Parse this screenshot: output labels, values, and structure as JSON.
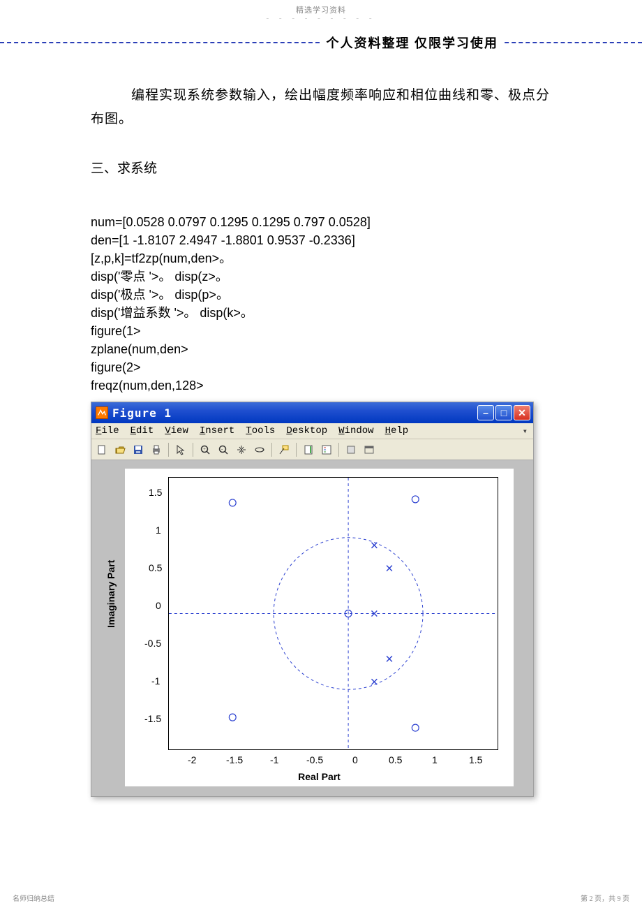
{
  "watermark": {
    "top": "精选学习资料",
    "dots": "- - - - - - - - -",
    "footer_left": "名师归纳总结",
    "footer_right": "第 2 页，共 9 页"
  },
  "header": {
    "text": "个人资料整理   仅限学习使用"
  },
  "body": {
    "para1": "编程实现系统参数输入，绘出幅度频率响应和相位曲线和零、极点分布图。",
    "section3": "三、求系统",
    "code_lines": [
      "num=[0.0528 0.0797 0.1295 0.1295 0.797 0.0528]",
      "den=[1 -1.8107 2.4947 -1.8801 0.9537 -0.2336]",
      "[z,p,k]=tf2zp(num,den>。",
      "disp('零点 '>。 disp(z>。",
      "disp('极点 '>。 disp(p>。",
      "disp('增益系数 '>。 disp(k>。",
      "figure(1>",
      "zplane(num,den>",
      "figure(2>",
      "freqz(num,den,128>"
    ]
  },
  "figure": {
    "title": "Figure 1",
    "menu": [
      "File",
      "Edit",
      "View",
      "Insert",
      "Tools",
      "Desktop",
      "Window",
      "Help"
    ],
    "toolbar_groups": [
      [
        "new",
        "open",
        "save",
        "print"
      ],
      [
        "arrow"
      ],
      [
        "zoom-in",
        "zoom-out",
        "pan",
        "rotate3d"
      ],
      [
        "data-cursor"
      ],
      [
        "colorbar",
        "legend"
      ],
      [
        "hide-tools",
        "dock"
      ]
    ],
    "xlabel": "Real Part",
    "ylabel": "Imaginary Part",
    "xticks": [
      "-2",
      "-1.5",
      "-1",
      "-0.5",
      "0",
      "0.5",
      "1",
      "1.5"
    ],
    "yticks": [
      "1.5",
      "1",
      "0.5",
      "0",
      "-0.5",
      "-1",
      "-1.5"
    ]
  },
  "chart_data": {
    "type": "scatter",
    "title": "",
    "xlabel": "Real Part",
    "ylabel": "Imaginary Part",
    "xlim": [
      -2.4,
      2.0
    ],
    "ylim": [
      -1.9,
      1.9
    ],
    "unit_circle": {
      "cx": 0,
      "cy": 0,
      "r": 1,
      "style": "dashed"
    },
    "crosshair": {
      "x": 0,
      "y": 0,
      "style": "dashed"
    },
    "series": [
      {
        "name": "zeros",
        "marker": "o",
        "points": [
          {
            "x": -1.55,
            "y": 1.55
          },
          {
            "x": -1.55,
            "y": -1.45
          },
          {
            "x": 0.0,
            "y": 0.0
          },
          {
            "x": 0.9,
            "y": 1.6
          },
          {
            "x": 0.9,
            "y": -1.6
          }
        ]
      },
      {
        "name": "poles",
        "marker": "x",
        "points": [
          {
            "x": 0.35,
            "y": 0.95
          },
          {
            "x": 0.55,
            "y": 0.6
          },
          {
            "x": 0.35,
            "y": 0.0
          },
          {
            "x": 0.55,
            "y": -0.6
          },
          {
            "x": 0.35,
            "y": -0.95
          }
        ]
      }
    ]
  }
}
